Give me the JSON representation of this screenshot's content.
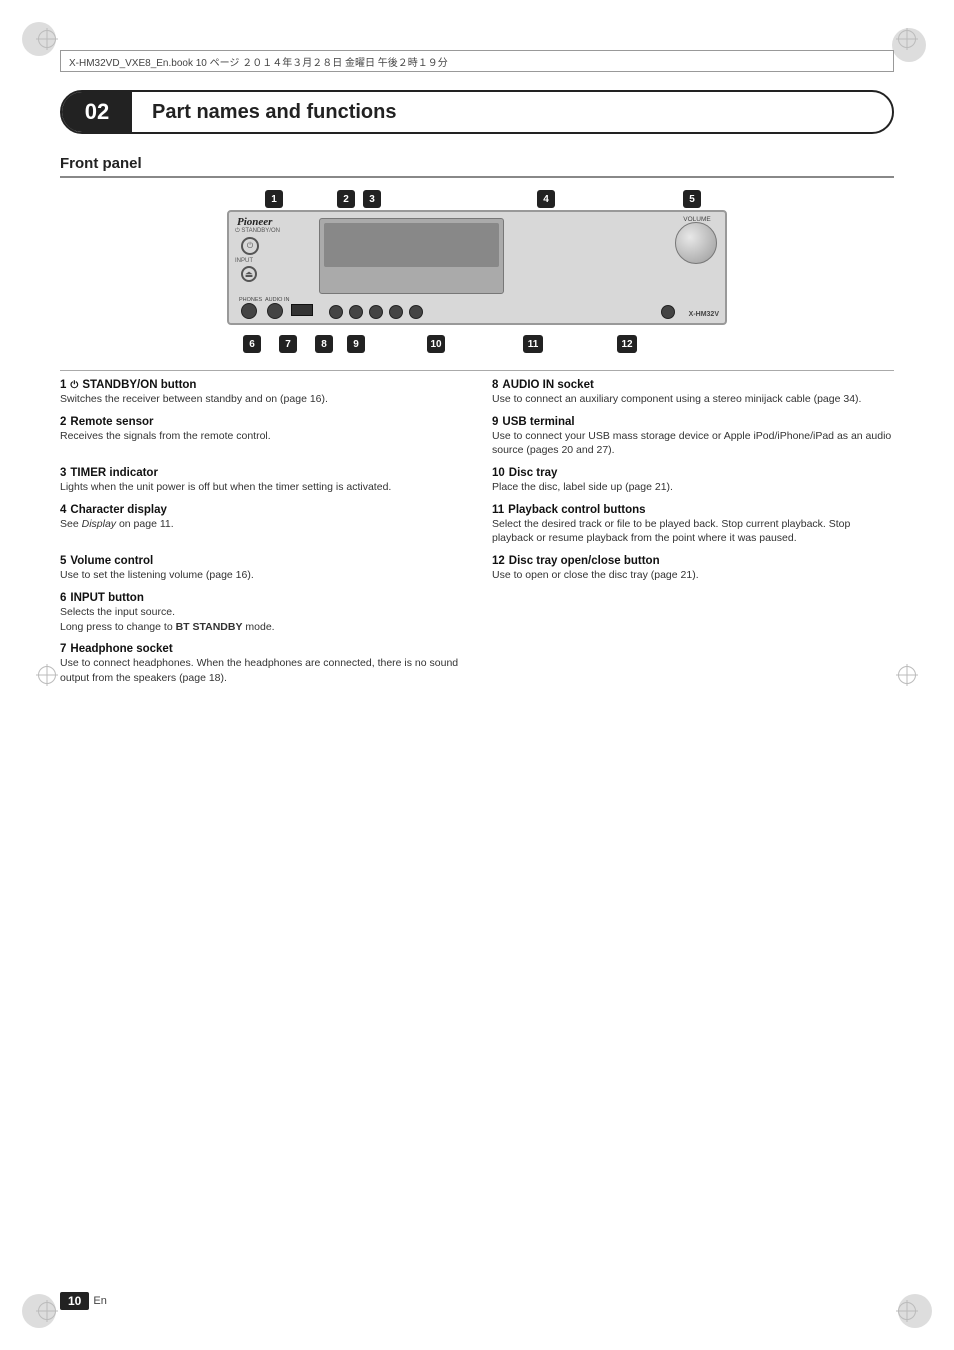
{
  "page": {
    "number": "10",
    "lang": "En"
  },
  "header": {
    "file_info": "X-HM32VD_VXE8_En.book  10 ページ  ２０１４年３月２８日  金曜日  午後２時１９分"
  },
  "chapter": {
    "number": "02",
    "title": "Part names and functions"
  },
  "front_panel": {
    "title": "Front panel",
    "brand": "Pioneer",
    "model": "X-HM32V",
    "standby_label": "STANDBY/ON",
    "input_label": "INPUT",
    "phones_label": "PHONES",
    "audio_in_label": "AUDIO IN",
    "volume_label": "VOLUME"
  },
  "callout_numbers": {
    "top": [
      "1",
      "2",
      "3",
      "4",
      "5"
    ],
    "bottom": [
      "6",
      "7",
      "8",
      "9",
      "10",
      "11",
      "12"
    ]
  },
  "descriptions": [
    {
      "num": "1",
      "icon": "⏻",
      "title": "STANDBY/ON button",
      "body": "Switches the receiver between standby and on (page 16)."
    },
    {
      "num": "8",
      "icon": "",
      "title": "AUDIO IN socket",
      "body": "Use to connect an auxiliary component using a stereo minijack cable (page 34)."
    },
    {
      "num": "2",
      "icon": "",
      "title": "Remote sensor",
      "body": "Receives the signals from the remote control."
    },
    {
      "num": "9",
      "icon": "",
      "title": "USB terminal",
      "body": "Use to connect your USB mass storage device or Apple iPod/iPhone/iPad as an audio source (pages 20 and 27)."
    },
    {
      "num": "3",
      "icon": "",
      "title": "TIMER indicator",
      "body": "Lights when the unit power is off but when the timer setting is activated."
    },
    {
      "num": "10",
      "icon": "",
      "title": "Disc tray",
      "body": "Place the disc, label side up (page 21)."
    },
    {
      "num": "4",
      "icon": "",
      "title": "Character display",
      "body": "See Display on page 11."
    },
    {
      "num": "11",
      "icon": "",
      "title": "Playback control buttons",
      "body": "Select the desired track or file to be played back. Stop current playback. Stop playback or resume playback from the point where it was paused."
    },
    {
      "num": "5",
      "icon": "",
      "title": "Volume control",
      "body": "Use to set the listening volume (page 16)."
    },
    {
      "num": "12",
      "icon": "",
      "title": "Disc tray open/close button",
      "body": "Use to open or close the disc tray (page 21)."
    },
    {
      "num": "6",
      "icon": "",
      "title": "INPUT button",
      "body": "Selects the input source.\nLong press to change to BT STANDBY mode."
    },
    {
      "num": "7",
      "icon": "",
      "title": "Headphone socket",
      "body": "Use to connect headphones. When the headphones are connected, there is no sound output from the speakers (page 18)."
    }
  ]
}
